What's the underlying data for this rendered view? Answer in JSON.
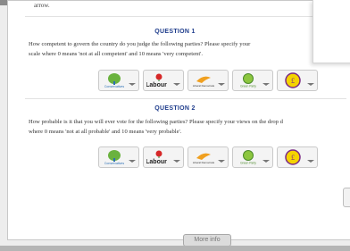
{
  "header": {
    "partial_text": "arrow."
  },
  "questions": [
    {
      "title": "QUESTION 1",
      "text": "How competent to govern the country do you judge the following parties? Please specify your\nscale where 0 means 'not at all competent' and 10 means 'very competent'."
    },
    {
      "title": "QUESTION 2",
      "text": "How probable is it that you will ever vote for the following parties? Please specify your views on the drop d\nwhere 0 means 'not at all probable' and 10 means 'very probable'."
    }
  ],
  "parties": [
    {
      "name": "Conservatives",
      "icon": "conservative-tree-icon",
      "color": "#2b6fb5"
    },
    {
      "name": "Labour",
      "icon": "labour-rose-icon",
      "color": "#d62828"
    },
    {
      "name": "Liberal Democrats",
      "icon": "libdem-bird-icon",
      "color": "#f0a020"
    },
    {
      "name": "Green Party",
      "icon": "green-party-icon",
      "color": "#6ab23e"
    },
    {
      "name": "UKIP",
      "icon": "ukip-pound-icon",
      "color": "#7b2a85"
    }
  ],
  "footer": {
    "more_info_label": "More info"
  }
}
